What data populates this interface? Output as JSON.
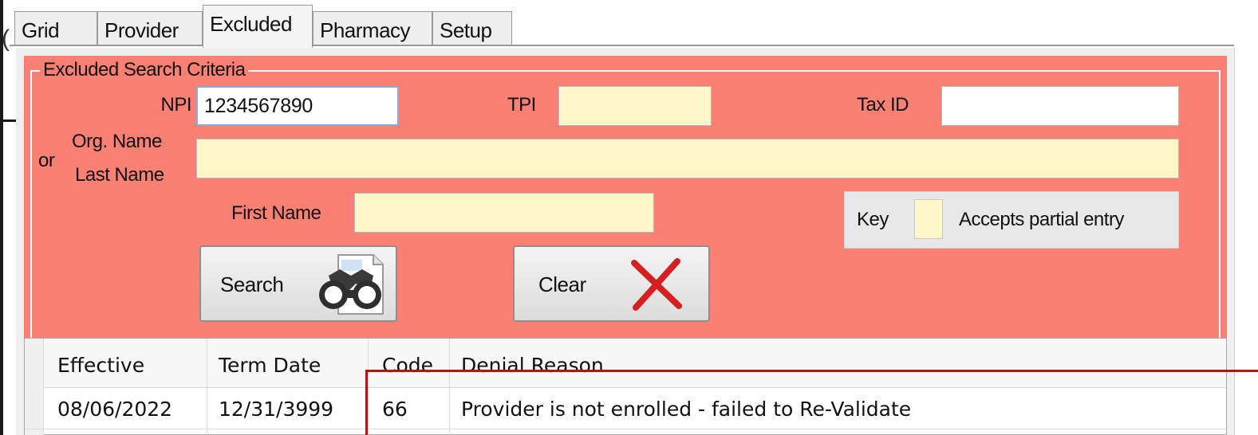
{
  "tabs": [
    {
      "label": "Grid",
      "active": false
    },
    {
      "label": "Provider",
      "active": false
    },
    {
      "label": "Excluded",
      "active": true
    },
    {
      "label": "Pharmacy",
      "active": false
    },
    {
      "label": "Setup",
      "active": false
    }
  ],
  "search_criteria": {
    "title": "Excluded Search Criteria",
    "npi": {
      "label": "NPI",
      "value": "1234567890"
    },
    "tpi": {
      "label": "TPI",
      "value": ""
    },
    "tax_id": {
      "label": "Tax ID",
      "value": ""
    },
    "or_label": "or",
    "org_name_label": "Org. Name",
    "last_name_label": "Last Name",
    "org_last_name": {
      "value": ""
    },
    "first_name": {
      "label": "First Name",
      "value": ""
    },
    "key": {
      "label": "Key",
      "description": "Accepts partial entry"
    },
    "search_button": {
      "label": "Search",
      "icon": "binoculars-icon"
    },
    "clear_button": {
      "label": "Clear",
      "icon": "red-x-icon"
    }
  },
  "colors": {
    "criteria_background": "#f98073",
    "partial_entry_field": "#fdf6c8",
    "clear_x": "#d42020",
    "highlight_border": "#b01818"
  },
  "grid": {
    "columns": [
      "Effective",
      "Term Date",
      "Code",
      "Denial Reason"
    ],
    "rows": [
      [
        "08/06/2022",
        "12/31/3999",
        "66",
        "Provider is not enrolled - failed to Re-Validate"
      ]
    ]
  }
}
